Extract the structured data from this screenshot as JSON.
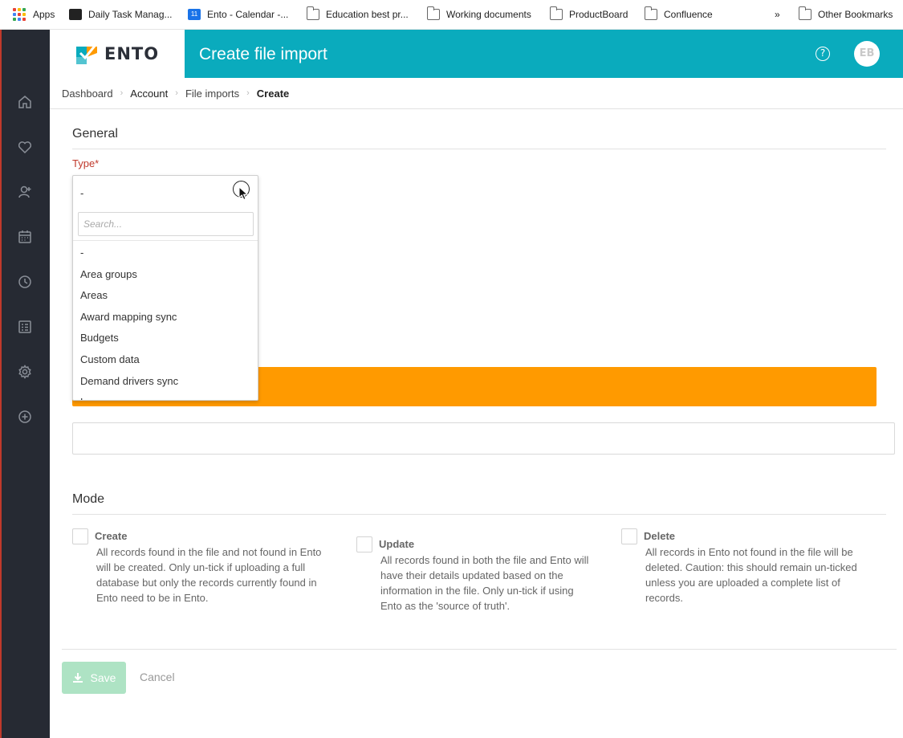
{
  "bookmarks_bar": {
    "items": [
      {
        "label": "Apps"
      },
      {
        "label": "Daily Task Manag..."
      },
      {
        "label": "Ento - Calendar -..."
      },
      {
        "label": "Education best pr..."
      },
      {
        "label": "Working documents"
      },
      {
        "label": "ProductBoard"
      },
      {
        "label": "Confluence"
      }
    ],
    "overflow": "»",
    "other": "Other Bookmarks",
    "calendar_badge": "11"
  },
  "sidebar": {
    "icons": [
      "home-icon",
      "heart-icon",
      "user-add-icon",
      "calendar-icon",
      "clock-icon",
      "report-icon",
      "gear-icon",
      "plus-circle-icon"
    ]
  },
  "header": {
    "logo_text": "ENTO",
    "title": "Create file import",
    "help": "?",
    "avatar_initials": "EB",
    "accent_color": "#0aabbd"
  },
  "breadcrumb": {
    "items": [
      "Dashboard",
      "Account",
      "File imports"
    ],
    "current": "Create"
  },
  "general": {
    "title": "General",
    "type_label": "Type*",
    "type_dropdown": {
      "selected": "-",
      "search_placeholder": "Search...",
      "options": [
        "-",
        "Area groups",
        "Areas",
        "Award mapping sync",
        "Budgets",
        "Custom data",
        "Demand drivers sync",
        "Leave"
      ]
    }
  },
  "mode": {
    "title": "Mode",
    "options": [
      {
        "title": "Create",
        "desc": "All records found in the file and not found in Ento will be created. Only un-tick if uploading a full database but only the records currently found in Ento need to be in Ento."
      },
      {
        "title": "Update",
        "desc": "All records found in both the file and Ento will have their details updated based on the information in the file. Only un-tick if using Ento as the 'source of truth'."
      },
      {
        "title": "Delete",
        "desc": "All records in Ento not found in the file will be deleted. Caution: this should remain un-ticked unless you are uploaded a complete list of records."
      }
    ]
  },
  "actions": {
    "save": "Save",
    "cancel": "Cancel"
  }
}
